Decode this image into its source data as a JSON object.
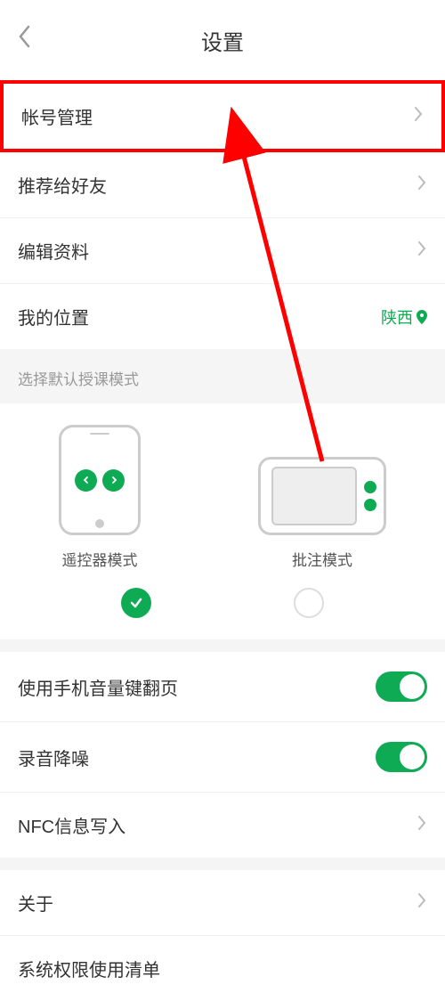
{
  "header": {
    "title": "设置"
  },
  "rows": {
    "account": "帐号管理",
    "recommend": "推荐给好友",
    "edit_profile": "编辑资料",
    "my_location": "我的位置",
    "location_value": "陕西",
    "volume_flip": "使用手机音量键翻页",
    "noise_reduction": "录音降噪",
    "nfc": "NFC信息写入",
    "about": "关于",
    "permissions": "系统权限使用清单"
  },
  "mode_section": {
    "label": "选择默认授课模式",
    "remote": "遥控器模式",
    "annotate": "批注模式"
  }
}
